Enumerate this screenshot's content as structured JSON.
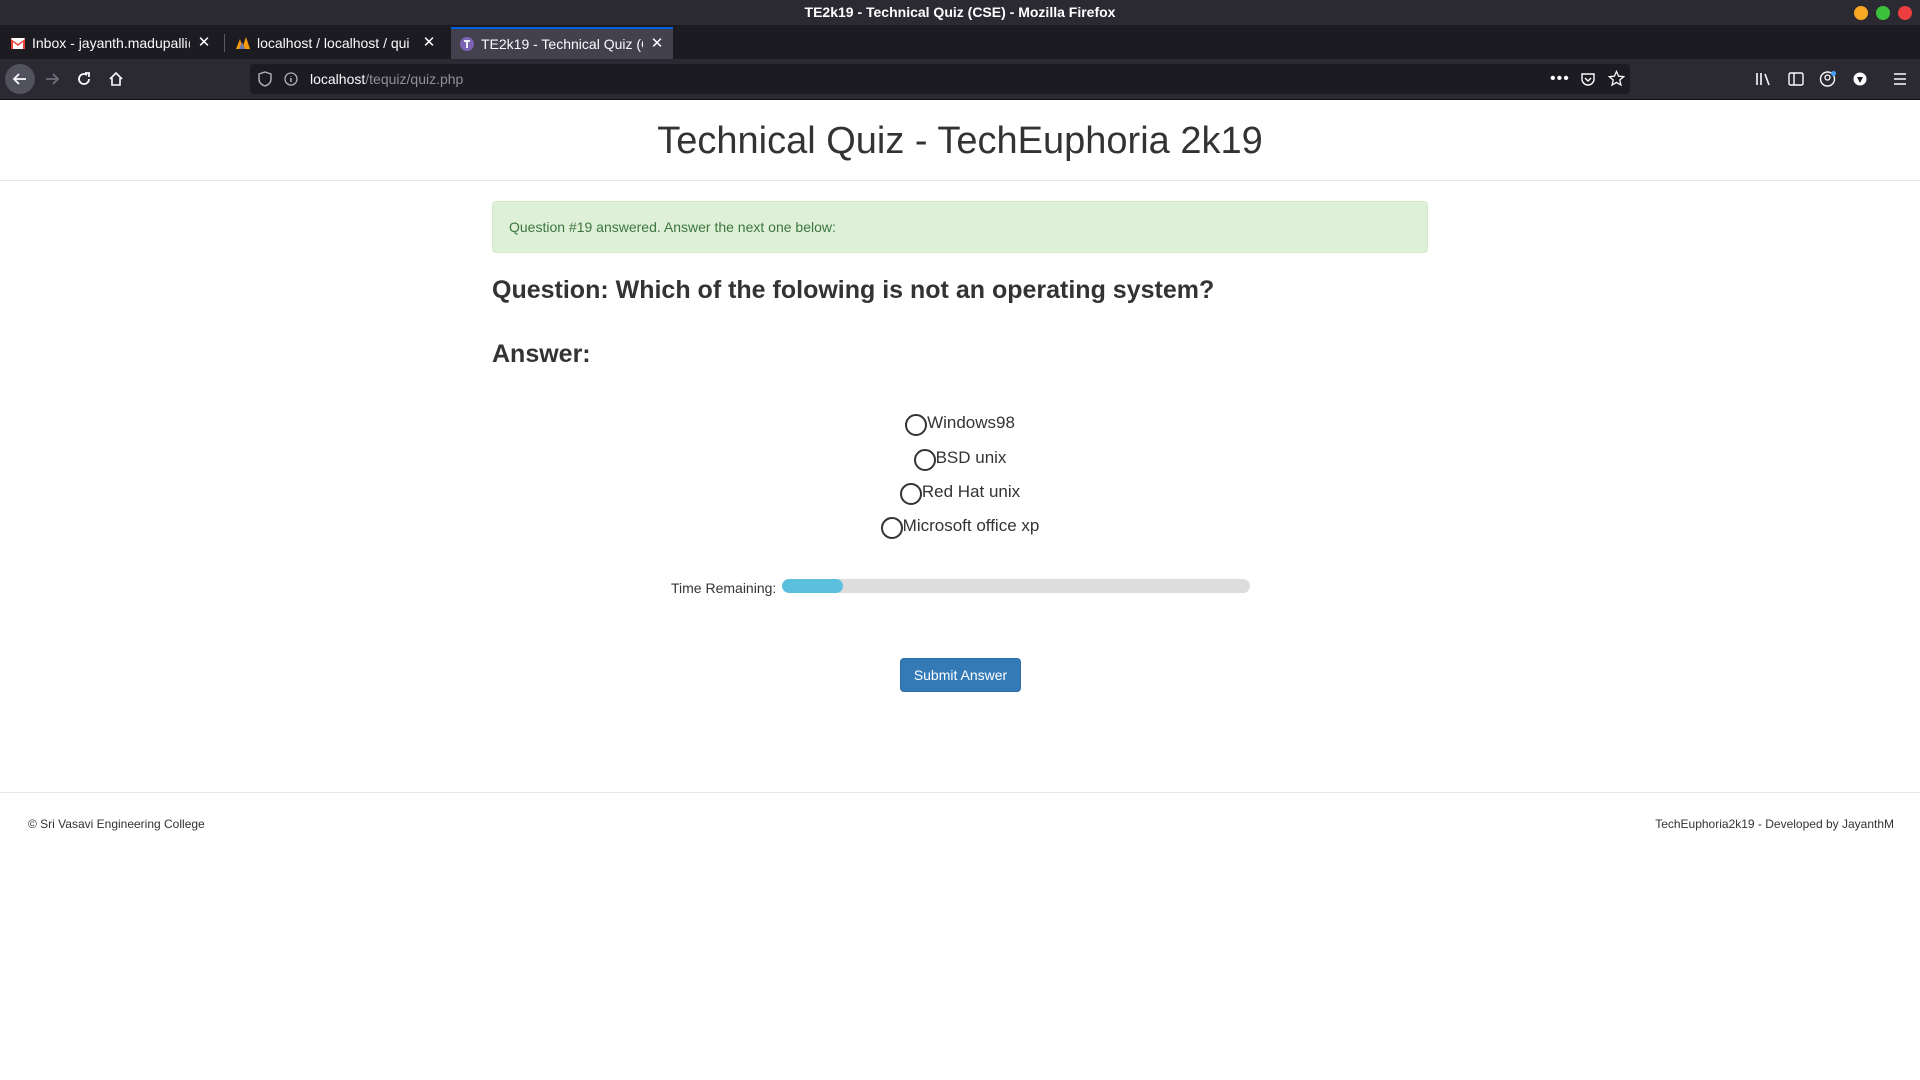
{
  "window": {
    "title": "TE2k19 - Technical Quiz (CSE) - Mozilla Firefox",
    "control_colors": [
      "#f6a823",
      "#3cc13b",
      "#ec3e3e"
    ]
  },
  "tabs": [
    {
      "label": "Inbox - jayanth.madupalli@",
      "icon": "gmail-icon",
      "active": false
    },
    {
      "label": "localhost / localhost / qui",
      "icon": "phpmyadmin-icon",
      "active": false
    },
    {
      "label": "TE2k19 - Technical Quiz (CS",
      "icon": "site-icon",
      "active": true
    }
  ],
  "url": {
    "host": "localhost",
    "path": "/tequiz/quiz.php"
  },
  "page": {
    "title": "Technical Quiz - TechEuphoria 2k19",
    "alert": "Question #19 answered. Answer the next one below:",
    "question": "Question: Which of the folowing is not an operating system?",
    "answer_label": "Answer:",
    "options": [
      "Windows98",
      "BSD unix",
      "Red Hat unix",
      "Microsoft office xp"
    ],
    "timer_label": "Time Remaining:",
    "time_remaining_fraction": 0.13,
    "submit_label": "Submit Answer"
  },
  "footer": {
    "left": "© Sri Vasavi Engineering College",
    "right": "TechEuphoria2k19 - Developed by JayanthM"
  },
  "colors": {
    "alert_bg": "#dff0d8",
    "alert_text": "#3c763d",
    "progress": "#5bc0de",
    "button": "#337ab7"
  }
}
